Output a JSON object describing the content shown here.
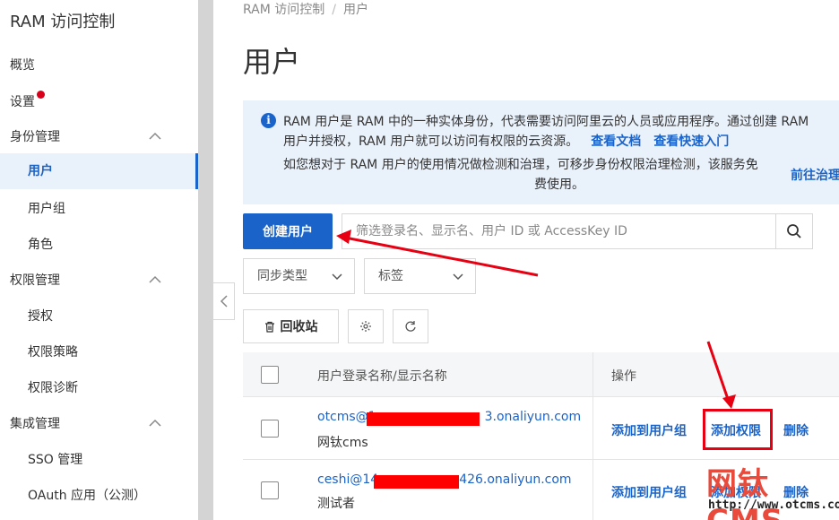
{
  "sidebar": {
    "title": "RAM 访问控制",
    "overview": "概览",
    "settings": "设置",
    "identity": {
      "label": "身份管理",
      "items": [
        "用户",
        "用户组",
        "角色"
      ]
    },
    "permissions": {
      "label": "权限管理",
      "items": [
        "授权",
        "权限策略",
        "权限诊断"
      ]
    },
    "integration": {
      "label": "集成管理",
      "items": [
        "SSO 管理",
        "OAuth 应用（公测）"
      ]
    }
  },
  "breadcrumb": {
    "root": "RAM 访问控制",
    "separator": "/",
    "current": "用户"
  },
  "page_title": "用户",
  "notice": {
    "line1": "RAM 用户是 RAM 中的一种实体身份，代表需要访问阿里云的人员或应用程序。通过创建 RAM",
    "line2": "用户并授权，RAM 用户就可以访问有权限的云资源。",
    "link_docs": "查看文档",
    "link_quickstart": "查看快速入门",
    "line3": "如您想对于 RAM 用户的使用情况做检测和治理，可移步身份权限治理检测，该服务免",
    "line4": "费使用。",
    "link_goto": "前往治理"
  },
  "toolbar": {
    "create_user": "创建用户",
    "search_placeholder": "筛选登录名、显示名、用户 ID 或 AccessKey ID",
    "sync_type": "同步类型",
    "tags": "标签",
    "recycle_bin": "回收站"
  },
  "table": {
    "col_user": "用户登录名称/显示名称",
    "col_actions": "操作",
    "rows": [
      {
        "login_prefix": "otcms@1",
        "login_suffix": "3.onaliyun.com",
        "display_name": "网钛cms"
      },
      {
        "login_prefix": "ceshi@14",
        "login_suffix": "426.onaliyun.com",
        "display_name": "测试者"
      }
    ],
    "actions": {
      "add_to_group": "添加到用户组",
      "add_permission": "添加权限",
      "delete": "删除"
    }
  },
  "watermark": {
    "logo": "网钛CMS",
    "url": "http://www.otcms.com"
  },
  "colors": {
    "brand_blue": "#1a63c9",
    "notice_bg": "#e9f1fb",
    "annotation_red": "#e60012"
  }
}
